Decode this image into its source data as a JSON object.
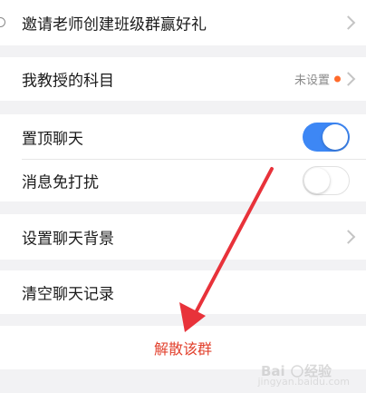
{
  "rows": {
    "invite_label": "邀请老师创建班级群赢好礼",
    "subject_label": "我教授的科目",
    "subject_value": "未设置",
    "pin_label": "置顶聊天",
    "pin_on": true,
    "mute_label": "消息免打扰",
    "mute_on": false,
    "background_label": "设置聊天背景",
    "clear_label": "清空聊天记录"
  },
  "dissolve": {
    "label": "解散该群"
  },
  "colors": {
    "accent_toggle": "#3d87f5",
    "dissolve_text": "#e2412d",
    "badge_dot": "#ff6a2a",
    "arrow": "#e8323a"
  },
  "watermark": {
    "text": "jingyan.baidu.com"
  }
}
